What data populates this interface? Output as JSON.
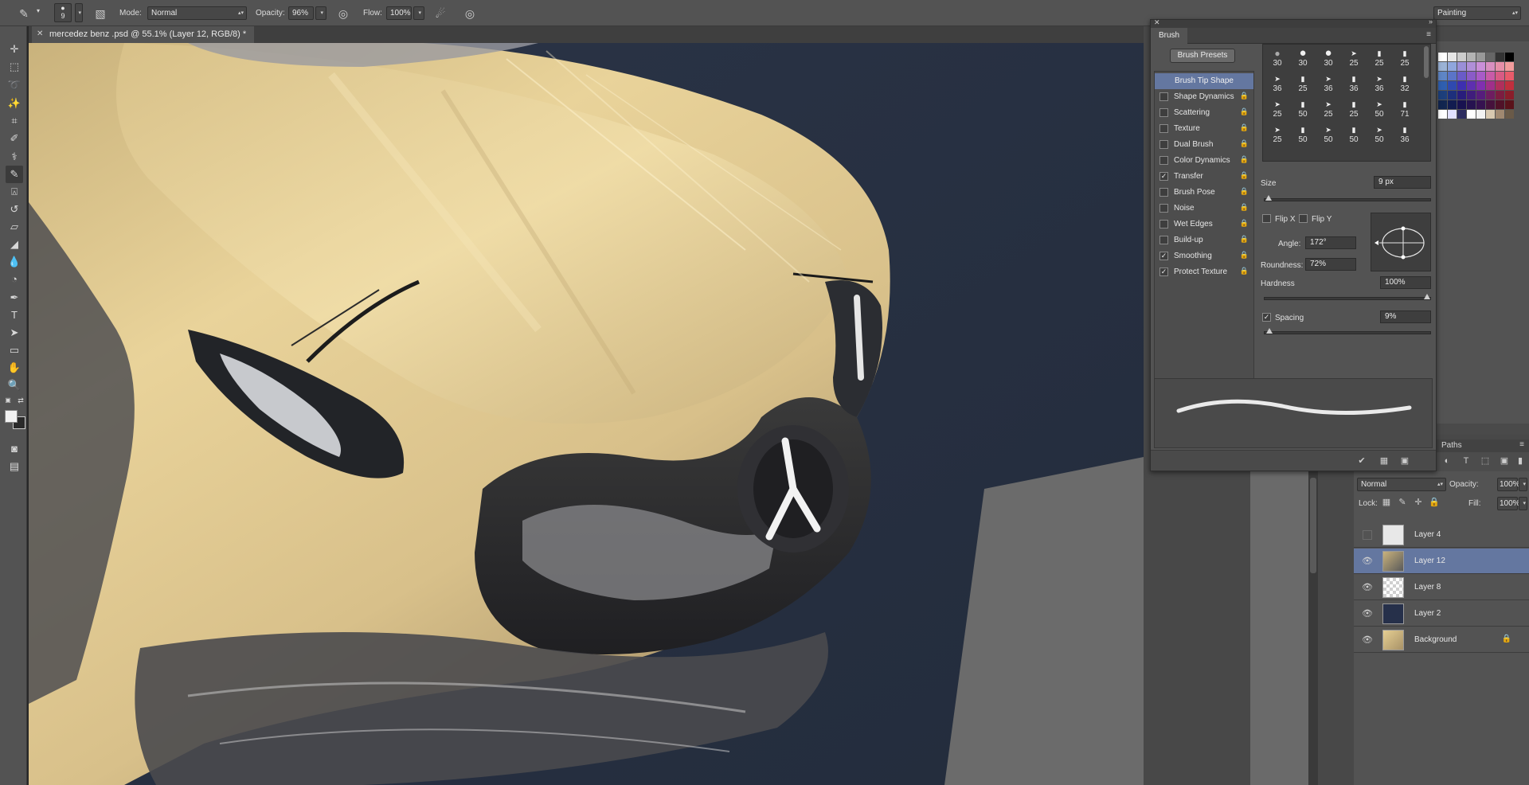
{
  "options_bar": {
    "brush_size": "9",
    "mode_label": "Mode:",
    "mode_value": "Normal",
    "opacity_label": "Opacity:",
    "opacity_value": "96%",
    "flow_label": "Flow:",
    "flow_value": "100%",
    "workspace_value": "Painting"
  },
  "document": {
    "tab_title": "mercedez benz .psd @ 55.1% (Layer 12, RGB/8) *"
  },
  "brush_panel": {
    "tab_label": "Brush",
    "presets_button": "Brush Presets",
    "tip_shape_label": "Brush Tip Shape",
    "options": [
      {
        "label": "Shape Dynamics",
        "checked": false
      },
      {
        "label": "Scattering",
        "checked": false
      },
      {
        "label": "Texture",
        "checked": false
      },
      {
        "label": "Dual Brush",
        "checked": false
      },
      {
        "label": "Color Dynamics",
        "checked": false
      },
      {
        "label": "Transfer",
        "checked": true
      },
      {
        "label": "Brush Pose",
        "checked": false
      },
      {
        "label": "Noise",
        "checked": false
      },
      {
        "label": "Wet Edges",
        "checked": false
      },
      {
        "label": "Build-up",
        "checked": false
      },
      {
        "label": "Smoothing",
        "checked": true
      },
      {
        "label": "Protect Texture",
        "checked": true
      }
    ],
    "tip_sizes": [
      "30",
      "30",
      "30",
      "25",
      "25",
      "25",
      "36",
      "25",
      "36",
      "36",
      "36",
      "32",
      "25",
      "50",
      "25",
      "25",
      "50",
      "71",
      "25",
      "50",
      "50",
      "50",
      "50",
      "36"
    ],
    "size_label": "Size",
    "size_value": "9 px",
    "flip_x_label": "Flip X",
    "flip_y_label": "Flip Y",
    "angle_label": "Angle:",
    "angle_value": "172°",
    "roundness_label": "Roundness:",
    "roundness_value": "72%",
    "hardness_label": "Hardness",
    "hardness_value": "100%",
    "spacing_label": "Spacing",
    "spacing_value": "9%",
    "spacing_checked": true
  },
  "layers_panel": {
    "paths_tab": "Paths",
    "blend_mode": "Normal",
    "opacity_label": "Opacity:",
    "opacity_value": "100%",
    "lock_label": "Lock:",
    "fill_label": "Fill:",
    "fill_value": "100%",
    "layers": [
      {
        "name": "Layer 4",
        "visible": false,
        "selected": false,
        "locked": false
      },
      {
        "name": "Layer 12",
        "visible": true,
        "selected": true,
        "locked": false
      },
      {
        "name": "Layer 8",
        "visible": true,
        "selected": false,
        "locked": false
      },
      {
        "name": "Layer 2",
        "visible": true,
        "selected": false,
        "locked": false
      },
      {
        "name": "Background",
        "visible": true,
        "selected": false,
        "locked": true
      }
    ]
  },
  "colors": {
    "selection": "#6477a0",
    "panel": "#535353",
    "canvas_bg": "#2c3546",
    "car_gold": "#e6cf92"
  }
}
